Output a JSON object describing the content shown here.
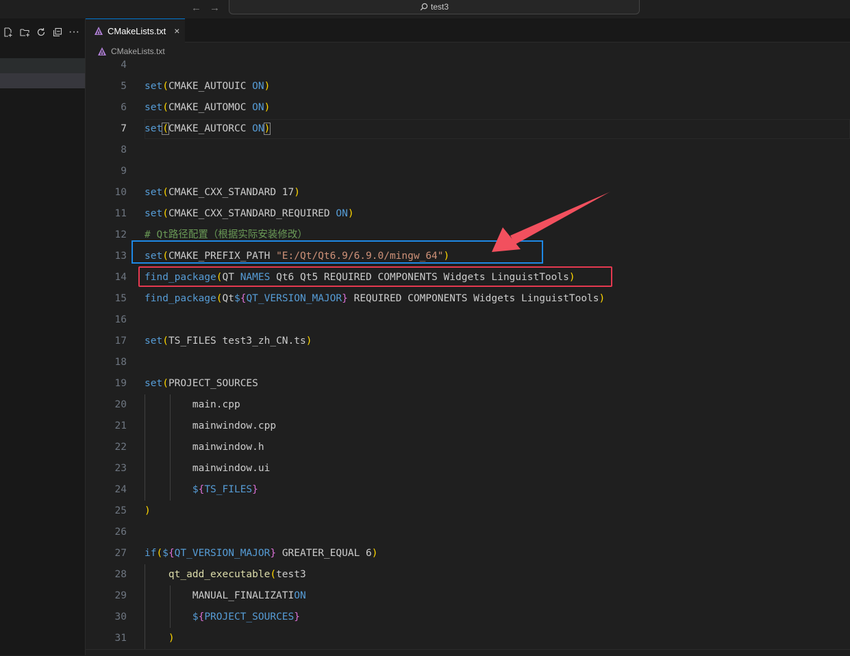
{
  "titlebar": {
    "back_icon": "arrow-left-icon",
    "forward_icon": "arrow-right-icon",
    "search_text": "test3"
  },
  "sidebar": {
    "toolbar": [
      "new-file-icon",
      "new-folder-icon",
      "refresh-icon",
      "collapse-all-icon",
      "more-icon"
    ],
    "more_label": "···"
  },
  "tab": {
    "label": "CMakeLists.txt",
    "close": "×"
  },
  "breadcrumb": {
    "file": "CMakeLists.txt"
  },
  "editor": {
    "active_line": 7,
    "lines": [
      {
        "n": "4",
        "code": ""
      },
      {
        "n": "5",
        "code": "set(CMAKE_AUTOUIC ON)"
      },
      {
        "n": "6",
        "code": "set(CMAKE_AUTOMOC ON)"
      },
      {
        "n": "7",
        "code": "set(CMAKE_AUTORCC ON)"
      },
      {
        "n": "8",
        "code": ""
      },
      {
        "n": "9",
        "code": ""
      },
      {
        "n": "10",
        "code": "set(CMAKE_CXX_STANDARD 17)"
      },
      {
        "n": "11",
        "code": "set(CMAKE_CXX_STANDARD_REQUIRED ON)"
      },
      {
        "n": "12",
        "code": "# Qt路径配置（根据实际安装修改）"
      },
      {
        "n": "13",
        "code": "set(CMAKE_PREFIX_PATH \"E:/Qt/Qt6.9/6.9.0/mingw_64\")"
      },
      {
        "n": "14",
        "code": "find_package(QT NAMES Qt6 Qt5 REQUIRED COMPONENTS Widgets LinguistTools)"
      },
      {
        "n": "15",
        "code": "find_package(Qt${QT_VERSION_MAJOR} REQUIRED COMPONENTS Widgets LinguistTools)"
      },
      {
        "n": "16",
        "code": ""
      },
      {
        "n": "17",
        "code": "set(TS_FILES test3_zh_CN.ts)"
      },
      {
        "n": "18",
        "code": ""
      },
      {
        "n": "19",
        "code": "set(PROJECT_SOURCES"
      },
      {
        "n": "20",
        "code": "        main.cpp"
      },
      {
        "n": "21",
        "code": "        mainwindow.cpp"
      },
      {
        "n": "22",
        "code": "        mainwindow.h"
      },
      {
        "n": "23",
        "code": "        mainwindow.ui"
      },
      {
        "n": "24",
        "code": "        ${TS_FILES}"
      },
      {
        "n": "25",
        "code": ")"
      },
      {
        "n": "26",
        "code": ""
      },
      {
        "n": "27",
        "code": "if(${QT_VERSION_MAJOR} GREATER_EQUAL 6)"
      },
      {
        "n": "28",
        "code": "    qt_add_executable(test3"
      },
      {
        "n": "29",
        "code": "        MANUAL_FINALIZATION"
      },
      {
        "n": "30",
        "code": "        ${PROJECT_SOURCES}"
      },
      {
        "n": "31",
        "code": "    )"
      }
    ]
  },
  "annotations": {
    "blue_box_line": "13",
    "red_box_line": "14",
    "arrow_color": "#f2505e",
    "blue_color": "#1e88e5",
    "red_color": "#e53950"
  }
}
